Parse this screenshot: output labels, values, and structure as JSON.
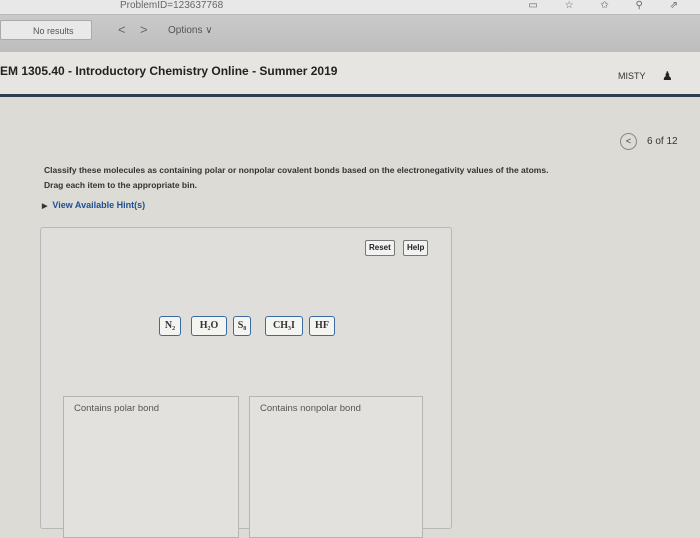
{
  "browser": {
    "url_fragment": "ProblemID=123637768",
    "find_field_text": "No results",
    "back_glyph": "<",
    "forward_glyph": ">",
    "options_label": "Options ∨",
    "toolbar_icons": "▭ ☆ ✩ ⚲ ⇗"
  },
  "header": {
    "course_title": "EM 1305.40 - Introductory Chemistry Online - Summer 2019",
    "user_name": "MISTY",
    "user_icon": "♟"
  },
  "pager": {
    "prev_glyph": "<",
    "position": "6 of 12"
  },
  "question": {
    "prompt_line1": "Classify these molecules as containing polar or nonpolar covalent bonds based on the electronegativity values of the atoms.",
    "prompt_line2": "Drag each item to the appropriate bin.",
    "hint_link": "View Available Hint(s)"
  },
  "workspace": {
    "reset_label": "Reset",
    "help_label": "Help",
    "chips": [
      {
        "label": "N₂"
      },
      {
        "label": "H₂O"
      },
      {
        "label": "S₈"
      },
      {
        "label": "CH₃I"
      },
      {
        "label": "HF"
      }
    ],
    "bins": [
      {
        "label": "Contains polar bond"
      },
      {
        "label": "Contains nonpolar bond"
      }
    ]
  },
  "colors": {
    "header_rule": "#2c3e50",
    "chip_border": "#3a6aa3",
    "link": "#1d4f91"
  }
}
